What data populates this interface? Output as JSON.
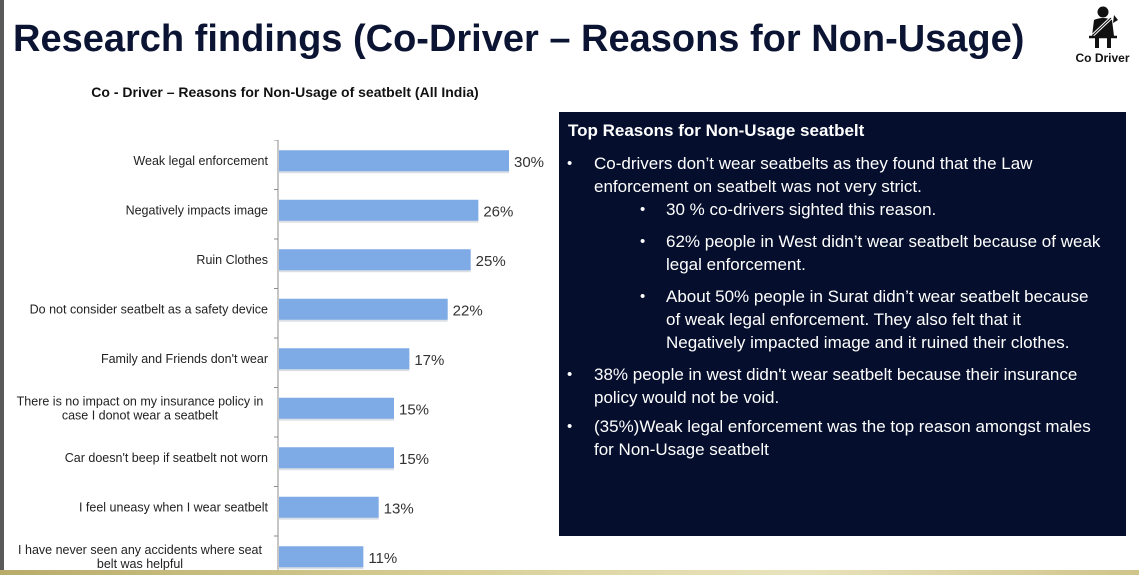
{
  "page": {
    "title": "Research findings (Co-Driver – Reasons for Non-Usage)",
    "logo": {
      "icon": "seatbelt-person-icon",
      "label": "Co Driver"
    }
  },
  "chart_data": {
    "type": "bar",
    "orientation": "horizontal",
    "title": "Co - Driver – Reasons for Non-Usage of seatbelt (All India)",
    "xlabel": "",
    "ylabel": "",
    "xlim": [
      0,
      30
    ],
    "grid": false,
    "legend": "none",
    "bar_color": "#7eaae6",
    "categories": [
      [
        "Weak legal enforcement"
      ],
      [
        "Negatively impacts image"
      ],
      [
        "Ruin Clothes"
      ],
      [
        "Do not consider seatbelt as a safety device"
      ],
      [
        "Family and Friends don't wear"
      ],
      [
        "There is no impact on my insurance policy in",
        "case I donot wear a seatbelt"
      ],
      [
        "Car doesn't beep if seatbelt not worn"
      ],
      [
        "I feel uneasy when I wear seatbelt"
      ],
      [
        "I have never seen any accidents where seat",
        "belt was helpful"
      ]
    ],
    "values": [
      30,
      26,
      25,
      22,
      17,
      15,
      15,
      13,
      11
    ],
    "data_labels": [
      "30%",
      "26%",
      "25%",
      "22%",
      "17%",
      "15%",
      "15%",
      "13%",
      "11%"
    ]
  },
  "panel": {
    "heading": "Top Reasons for Non-Usage seatbelt",
    "bullets": [
      {
        "text": "Co-drivers don’t wear seatbelts as they found that the Law enforcement on seatbelt was not very strict.",
        "sub": [
          "30 % co-drivers sighted this reason.",
          "62% people in West didn’t wear seatbelt because of weak legal enforcement.",
          "About 50% people in Surat didn’t wear seatbelt because of weak legal enforcement. They also felt that it Negatively impacted image and it ruined their clothes."
        ]
      },
      {
        "text": "38% people in west didn't wear seatbelt because their insurance policy would not be void."
      },
      {
        "text": "(35%)Weak legal enforcement was the top reason amongst males for Non-Usage seatbelt"
      }
    ]
  }
}
